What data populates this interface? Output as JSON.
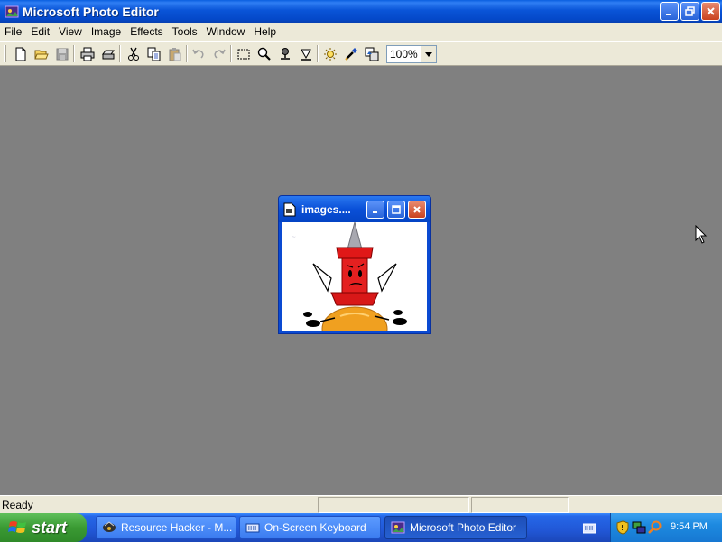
{
  "window": {
    "title": "Microsoft Photo Editor",
    "controls": [
      "minimize",
      "restore",
      "close"
    ]
  },
  "menu": {
    "items": [
      "File",
      "Edit",
      "View",
      "Image",
      "Effects",
      "Tools",
      "Window",
      "Help"
    ]
  },
  "toolbar": {
    "buttons": [
      "new-icon",
      "open-icon",
      "save-icon",
      "print-icon",
      "scan-icon",
      "cut-icon",
      "copy-icon",
      "paste-icon",
      "undo-icon",
      "redo-icon",
      "select-icon",
      "zoom-icon",
      "smudge-icon",
      "sharpen-icon",
      "balance-icon",
      "eyedropper-icon",
      "image-properties-icon"
    ],
    "zoom_value": "100%"
  },
  "document_window": {
    "title": "images....",
    "controls": [
      "minimize",
      "maximize",
      "close"
    ],
    "image_description": "red pushpin character on orange ball"
  },
  "status": {
    "text": "Ready"
  },
  "taskbar": {
    "start_label": "start",
    "tasks": [
      {
        "label": "Resource Hacker - M...",
        "active": false
      },
      {
        "label": "On-Screen Keyboard",
        "active": false
      },
      {
        "label": "Microsoft Photo Editor",
        "active": true
      }
    ],
    "clock": "9:54 PM"
  },
  "colors": {
    "title_blue": "#0a55d8",
    "chrome": "#ece9d8",
    "workspace": "#808080",
    "start_green": "#3a9a33",
    "close_red": "#c9421f"
  }
}
